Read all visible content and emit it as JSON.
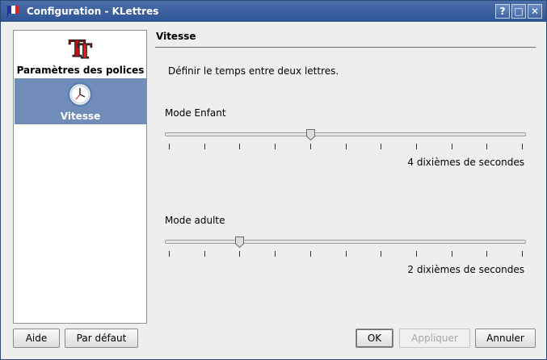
{
  "window": {
    "title": "Configuration - KLettres",
    "buttons": {
      "help": "?",
      "maximize": "□",
      "close": "✕"
    }
  },
  "sidebar": {
    "items": [
      {
        "label": "Paramètres des polices",
        "icon": "font-settings-icon",
        "selected": false
      },
      {
        "label": "Vitesse",
        "icon": "clock-icon",
        "selected": true
      }
    ]
  },
  "page": {
    "title": "Vitesse",
    "description": "Définir le temps entre deux lettres."
  },
  "sliders": [
    {
      "label": "Mode Enfant",
      "value": 4,
      "min": 0,
      "max": 10,
      "value_text": "4 dixièmes de secondes"
    },
    {
      "label": "Mode adulte",
      "value": 2,
      "min": 0,
      "max": 10,
      "value_text": "2 dixièmes de secondes"
    }
  ],
  "buttons": {
    "help": "Aide",
    "defaults": "Par défaut",
    "ok": "OK",
    "apply": "Appliquer",
    "cancel": "Annuler"
  },
  "colors": {
    "titlebar": "#2f5595",
    "selection": "#6f8db8"
  }
}
